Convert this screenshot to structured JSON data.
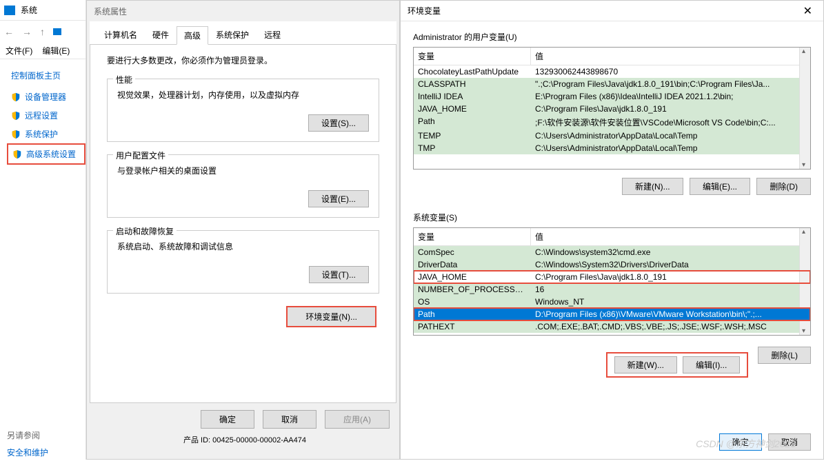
{
  "sys": {
    "title": "系统",
    "menu": {
      "file": "文件(F)",
      "edit": "编辑(E)"
    },
    "side_header": "控制面板主页",
    "links": {
      "devmgr": "设备管理器",
      "remote": "远程设置",
      "sysprotect": "系统保护",
      "advsys": "高级系统设置"
    },
    "extra": {
      "ref": "另请参阅",
      "secmaint": "安全和维护"
    },
    "prodid": "产品 ID: 00425-00000-00002-AA474"
  },
  "props": {
    "title": "系统属性",
    "tabs": {
      "computer": "计算机名",
      "hardware": "硬件",
      "advanced": "高级",
      "protect": "系统保护",
      "remote": "远程"
    },
    "note": "要进行大多数更改，你必须作为管理员登录。",
    "perf": {
      "title": "性能",
      "desc": "视觉效果，处理器计划，内存使用，以及虚拟内存",
      "btn": "设置(S)..."
    },
    "profile": {
      "title": "用户配置文件",
      "desc": "与登录帐户相关的桌面设置",
      "btn": "设置(E)..."
    },
    "startup": {
      "title": "启动和故障恢复",
      "desc": "系统启动、系统故障和调试信息",
      "btn": "设置(T)..."
    },
    "envbtn": "环境变量(N)...",
    "ok": "确定",
    "cancel": "取消",
    "apply": "应用(A)"
  },
  "env": {
    "title": "环境变量",
    "user_section": "Administrator 的用户变量(U)",
    "sys_section": "系统变量(S)",
    "col_var": "变量",
    "col_val": "值",
    "user_vars": [
      {
        "var": "ChocolateyLastPathUpdate",
        "val": "132930062443898670",
        "green": false
      },
      {
        "var": "CLASSPATH",
        "val": "\".;C:\\Program Files\\Java\\jdk1.8.0_191\\bin;C:\\Program Files\\Ja...",
        "green": true
      },
      {
        "var": "IntelliJ IDEA",
        "val": "E:\\Program Files (x86)\\Idea\\IntelliJ IDEA 2021.1.2\\bin;",
        "green": true
      },
      {
        "var": "JAVA_HOME",
        "val": "C:\\Program Files\\Java\\jdk1.8.0_191",
        "green": true
      },
      {
        "var": "Path",
        "val": ";F:\\软件安装源\\软件安装位置\\VSCode\\Microsoft VS Code\\bin;C:...",
        "green": true
      },
      {
        "var": "TEMP",
        "val": "C:\\Users\\Administrator\\AppData\\Local\\Temp",
        "green": true
      },
      {
        "var": "TMP",
        "val": "C:\\Users\\Administrator\\AppData\\Local\\Temp",
        "green": true
      }
    ],
    "sys_vars": [
      {
        "var": "ComSpec",
        "val": "C:\\Windows\\system32\\cmd.exe",
        "green": true
      },
      {
        "var": "DriverData",
        "val": "C:\\Windows\\System32\\Drivers\\DriverData",
        "green": true
      },
      {
        "var": "JAVA_HOME",
        "val": "C:\\Program Files\\Java\\jdk1.8.0_191",
        "green": false,
        "redbox": true
      },
      {
        "var": "NUMBER_OF_PROCESSORS",
        "val": "16",
        "green": true
      },
      {
        "var": "OS",
        "val": "Windows_NT",
        "green": true
      },
      {
        "var": "Path",
        "val": "D:\\Program Files (x86)\\VMware\\VMware Workstation\\bin\\;\".;...",
        "blue": true,
        "redbox": true
      },
      {
        "var": "PATHEXT",
        "val": ".COM;.EXE;.BAT;.CMD;.VBS;.VBE;.JS;.JSE;.WSF;.WSH;.MSC",
        "green": true
      }
    ],
    "btns": {
      "newN": "新建(N)...",
      "editE": "编辑(E)...",
      "delD": "删除(D)",
      "newW": "新建(W)...",
      "editI": "编辑(I)...",
      "delL": "删除(L)"
    },
    "ok": "确定",
    "cancel": "取消"
  },
  "watermark": "CSDN @东方神剑2023"
}
